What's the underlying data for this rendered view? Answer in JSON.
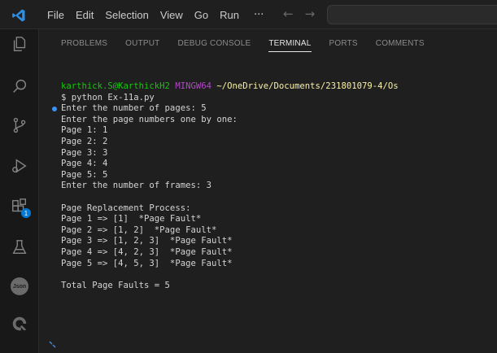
{
  "titlebar": {
    "menu": [
      "File",
      "Edit",
      "Selection",
      "View",
      "Go",
      "Run"
    ],
    "more": "···",
    "back": "←",
    "forward": "→"
  },
  "activitybar": {
    "icons": [
      "explorer-icon",
      "search-icon",
      "source-control-icon",
      "run-debug-icon",
      "extensions-icon",
      "testing-icon",
      "json-icon",
      "remote-icon"
    ],
    "extensions_badge": "1",
    "json_label": "Json"
  },
  "panel": {
    "tabs": [
      "PROBLEMS",
      "OUTPUT",
      "DEBUG CONSOLE",
      "TERMINAL",
      "PORTS",
      "COMMENTS"
    ],
    "active_tab": "TERMINAL"
  },
  "terminal": {
    "prompt_user": "karthick.S@KarthickH2",
    "prompt_shell": "MINGW64",
    "prompt_path": "~/OneDrive/Documents/231801079-4/Os",
    "command": "$ python Ex-11a.py",
    "output": [
      "Enter the number of pages: 5",
      "Enter the page numbers one by one:",
      "Page 1: 1",
      "Page 2: 2",
      "Page 3: 3",
      "Page 4: 4",
      "Page 5: 5",
      "Enter the number of frames: 3",
      "",
      "Page Replacement Process:",
      "Page 1 => [1]  *Page Fault*",
      "Page 2 => [1, 2]  *Page Fault*",
      "Page 3 => [1, 2, 3]  *Page Fault*",
      "Page 4 => [4, 2, 3]  *Page Fault*",
      "Page 5 => [4, 5, 3]  *Page Fault*",
      "",
      "Total Page Faults = 5"
    ]
  },
  "colors": {
    "accent": "#0078d4",
    "prompt_user": "#16c60c",
    "prompt_shell": "#b148c6",
    "prompt_path": "#f9f1a5"
  }
}
